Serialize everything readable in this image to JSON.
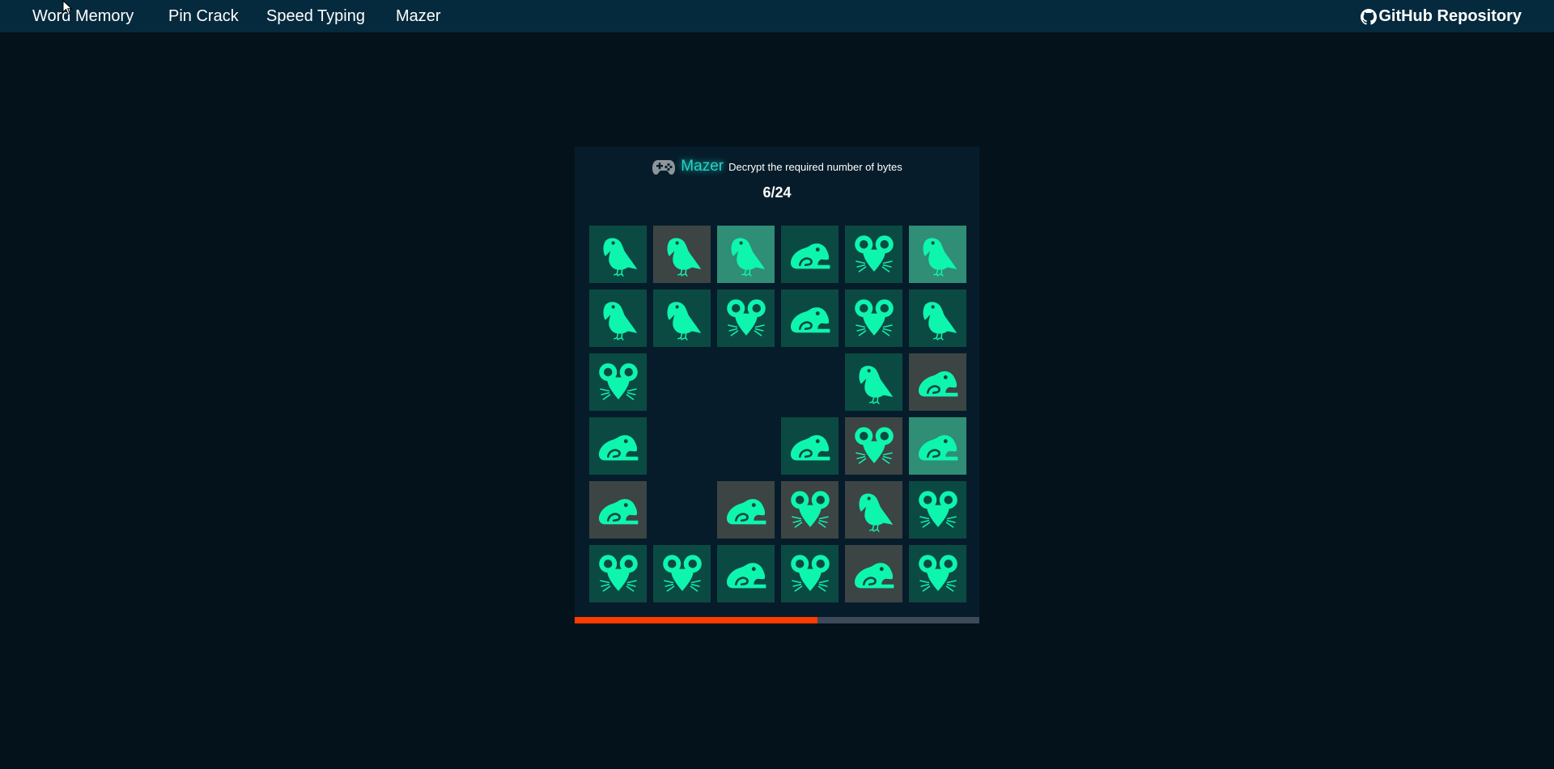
{
  "nav": {
    "links": [
      "Word Memory",
      "Pin Crack",
      "Speed Typing",
      "Mazer"
    ],
    "github_label": "GitHub Repository"
  },
  "game": {
    "title": "Mazer",
    "description": "Decrypt the required number of bytes",
    "counter": "6/24",
    "progress_fraction": 0.6,
    "grid_size": 6,
    "tiles": [
      [
        "bird-normal",
        "bird-grey",
        "bird-light",
        "frog-normal",
        "mouse-normal",
        "bird-light"
      ],
      [
        "bird-normal",
        "bird-normal",
        "mouse-normal",
        "frog-normal",
        "mouse-normal",
        "bird-normal"
      ],
      [
        "mouse-normal",
        "empty",
        "empty",
        "empty",
        "bird-normal",
        "frog-grey"
      ],
      [
        "frog-normal",
        "empty",
        "empty",
        "frog-normal",
        "mouse-grey",
        "frog-light"
      ],
      [
        "frog-grey",
        "empty",
        "frog-grey",
        "mouse-grey",
        "bird-grey",
        "mouse-normal"
      ],
      [
        "mouse-normal",
        "mouse-normal",
        "frog-normal",
        "mouse-normal",
        "frog-grey",
        "mouse-normal"
      ]
    ]
  },
  "colors": {
    "background": "#04121b",
    "navbar": "#052a3d",
    "panel": "#061c2a",
    "icon": "#0ef5ae",
    "tile_normal": "#0b4a43",
    "tile_grey": "#3d4444",
    "tile_light": "#2f8e75",
    "progress_fill": "#ff3c00",
    "progress_track": "#3d4a58",
    "title_accent": "#27d3c6"
  }
}
